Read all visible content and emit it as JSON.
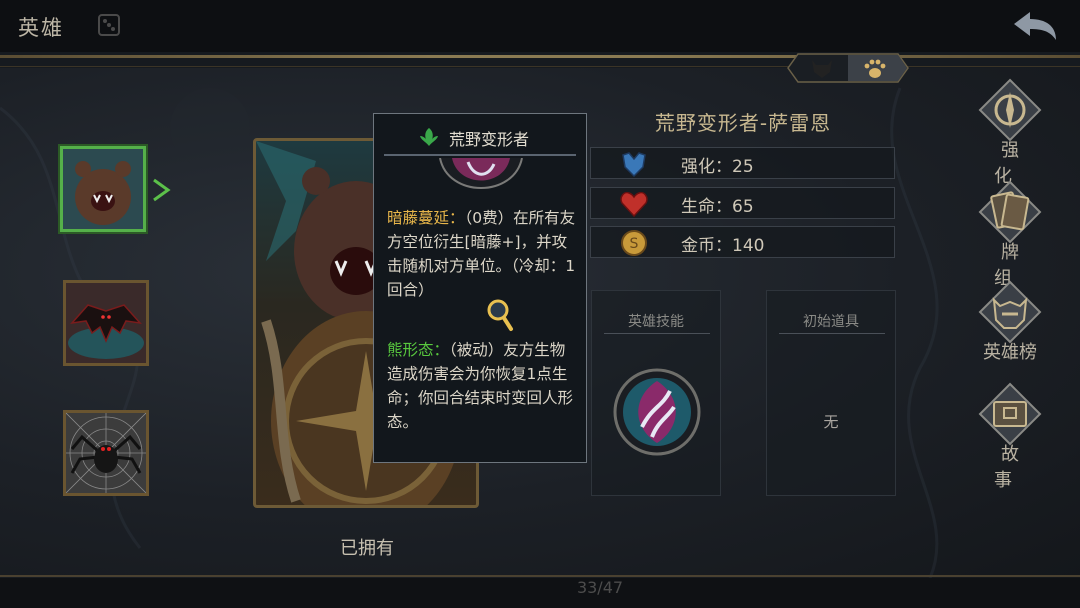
{
  "header": {
    "title": "英雄",
    "dice_icon": "dice-icon",
    "back_icon": "back-arrow-icon"
  },
  "category_toggle": {
    "options": [
      "demon-head-icon",
      "paw-icon"
    ],
    "selected": "paw-icon"
  },
  "hero_list": [
    {
      "id": "bear",
      "icon": "bear-portrait",
      "selected": true
    },
    {
      "id": "bat",
      "icon": "bat-portrait",
      "selected": false
    },
    {
      "id": "spider",
      "icon": "spider-portrait",
      "selected": false
    }
  ],
  "portrait": {
    "owned_label": "已拥有"
  },
  "tooltip": {
    "title": "荒野变形者",
    "title_icon": "leaf-icon",
    "skill1_name": "暗藤蔓延：",
    "skill1_cost": "（0费）",
    "skill1_text": "在所有友方空位衍生[暗藤+]，并攻击随机对方单位。（冷却：1回合）",
    "skill2_name": "熊形态：",
    "skill2_text": "（被动）友方生物造成伤害会为你恢复1点生命；你回合结束时变回人形态。"
  },
  "hero": {
    "name": "荒野变形者-萨雷恩",
    "stats": [
      {
        "icon": "shield-icon",
        "text": "强化：25",
        "color": "#3a78b8"
      },
      {
        "icon": "heart-icon",
        "text": "生命：65",
        "color": "#c0302a"
      },
      {
        "icon": "coin-icon",
        "text": "金币：140",
        "color": "#c89a3a"
      }
    ],
    "skill_title": "英雄技能",
    "item_title": "初始道具",
    "item_value": "无"
  },
  "menu": [
    {
      "icon": "compass-icon",
      "label": "强化"
    },
    {
      "icon": "cards-icon",
      "label": "牌组"
    },
    {
      "icon": "helmet-icon",
      "label": "英雄榜"
    },
    {
      "icon": "book-icon",
      "label": "故事"
    }
  ],
  "footer": {
    "page": "33/47"
  }
}
